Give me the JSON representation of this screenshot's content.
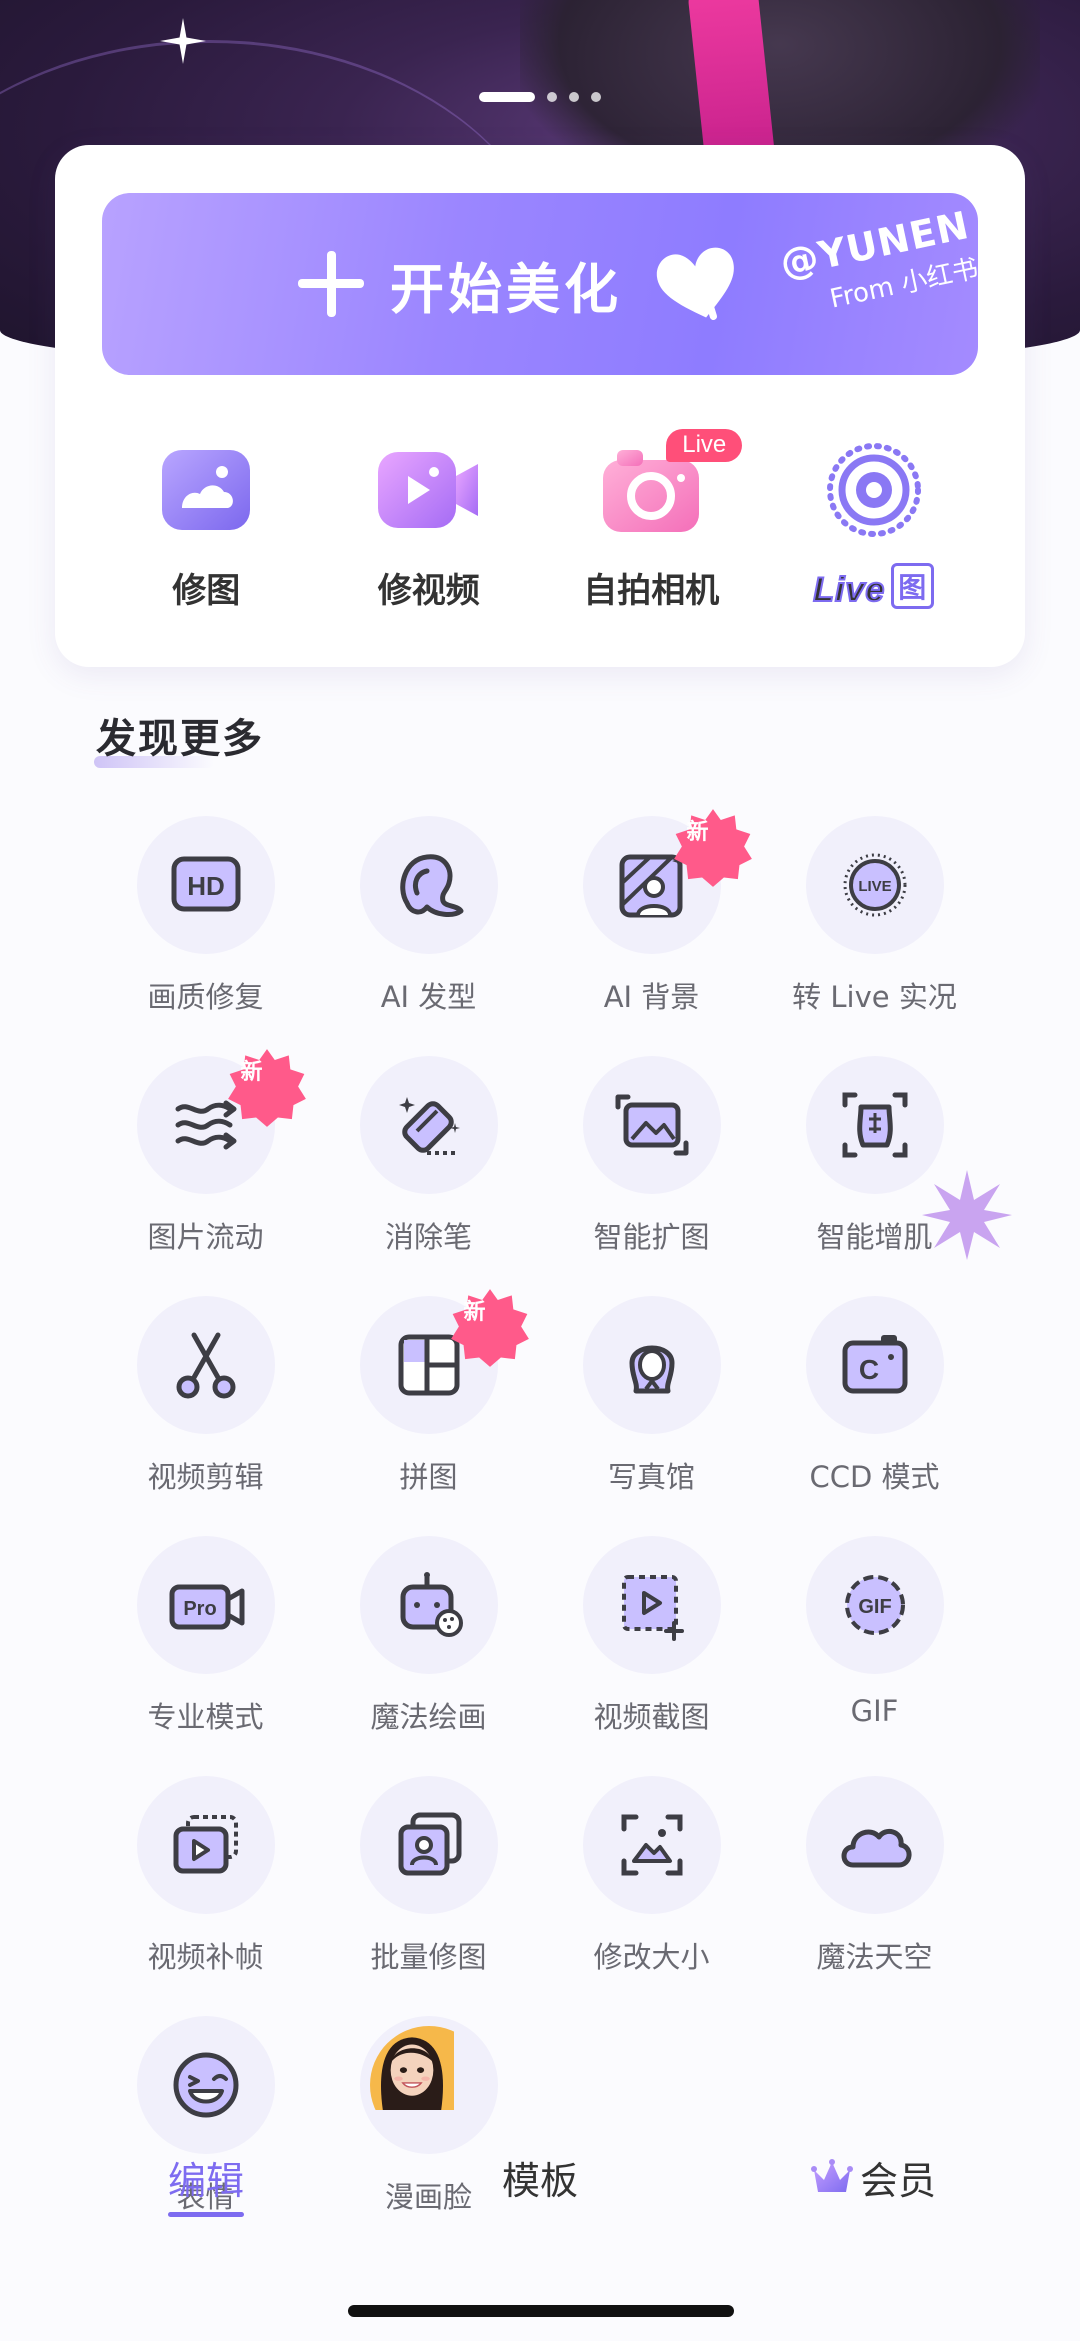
{
  "banner": {
    "pager_count": 4,
    "pager_active": 0
  },
  "cta": {
    "label": "开始美化",
    "watermark_handle": "@YUNEN",
    "watermark_from": "From 小红书"
  },
  "quick_actions": [
    {
      "id": "edit-photo",
      "label": "修图",
      "icon": "photo-icon"
    },
    {
      "id": "edit-video",
      "label": "修视频",
      "icon": "video-camera-icon"
    },
    {
      "id": "selfie-camera",
      "label": "自拍相机",
      "icon": "camera-icon",
      "badge": "Live"
    },
    {
      "id": "live-photo",
      "label": "Live",
      "label_badge": "图",
      "icon": "live-ring-icon"
    }
  ],
  "discover": {
    "title": "发现更多",
    "tools": [
      {
        "label": "画质修复",
        "icon": "hd-icon"
      },
      {
        "label": "AI 发型",
        "icon": "hair-icon"
      },
      {
        "label": "AI 背景",
        "icon": "background-icon",
        "badge": "新"
      },
      {
        "label": "转 Live 实况",
        "icon": "live-icon"
      },
      {
        "label": "图片流动",
        "icon": "flow-icon",
        "badge": "新"
      },
      {
        "label": "消除笔",
        "icon": "eraser-icon"
      },
      {
        "label": "智能扩图",
        "icon": "expand-icon"
      },
      {
        "label": "智能增肌",
        "icon": "muscle-icon"
      },
      {
        "label": "视频剪辑",
        "icon": "scissors-icon"
      },
      {
        "label": "拼图",
        "icon": "collage-icon",
        "badge": "新"
      },
      {
        "label": "写真馆",
        "icon": "portrait-icon"
      },
      {
        "label": "CCD 模式",
        "icon": "ccd-icon"
      },
      {
        "label": "专业模式",
        "icon": "pro-icon"
      },
      {
        "label": "魔法绘画",
        "icon": "robot-paint-icon"
      },
      {
        "label": "视频截图",
        "icon": "video-capture-icon"
      },
      {
        "label": "GIF",
        "icon": "gif-icon"
      },
      {
        "label": "视频补帧",
        "icon": "frames-icon"
      },
      {
        "label": "批量修图",
        "icon": "batch-icon"
      },
      {
        "label": "修改大小",
        "icon": "resize-icon"
      },
      {
        "label": "魔法天空",
        "icon": "cloud-icon"
      },
      {
        "label": "表情",
        "icon": "wink-icon"
      },
      {
        "label": "漫画脸",
        "icon": "cartoon-face-avatar"
      }
    ]
  },
  "bottom_nav": [
    {
      "label": "编辑",
      "active": true
    },
    {
      "label": "模板",
      "active": false
    },
    {
      "label": "会员",
      "active": false,
      "icon": "crown-icon"
    }
  ],
  "colors": {
    "accent": "#7d6bf0",
    "badge_pink": "#ff4f79",
    "icon_stroke": "#3d3d44",
    "circle_bg": "#f1f0fb"
  }
}
